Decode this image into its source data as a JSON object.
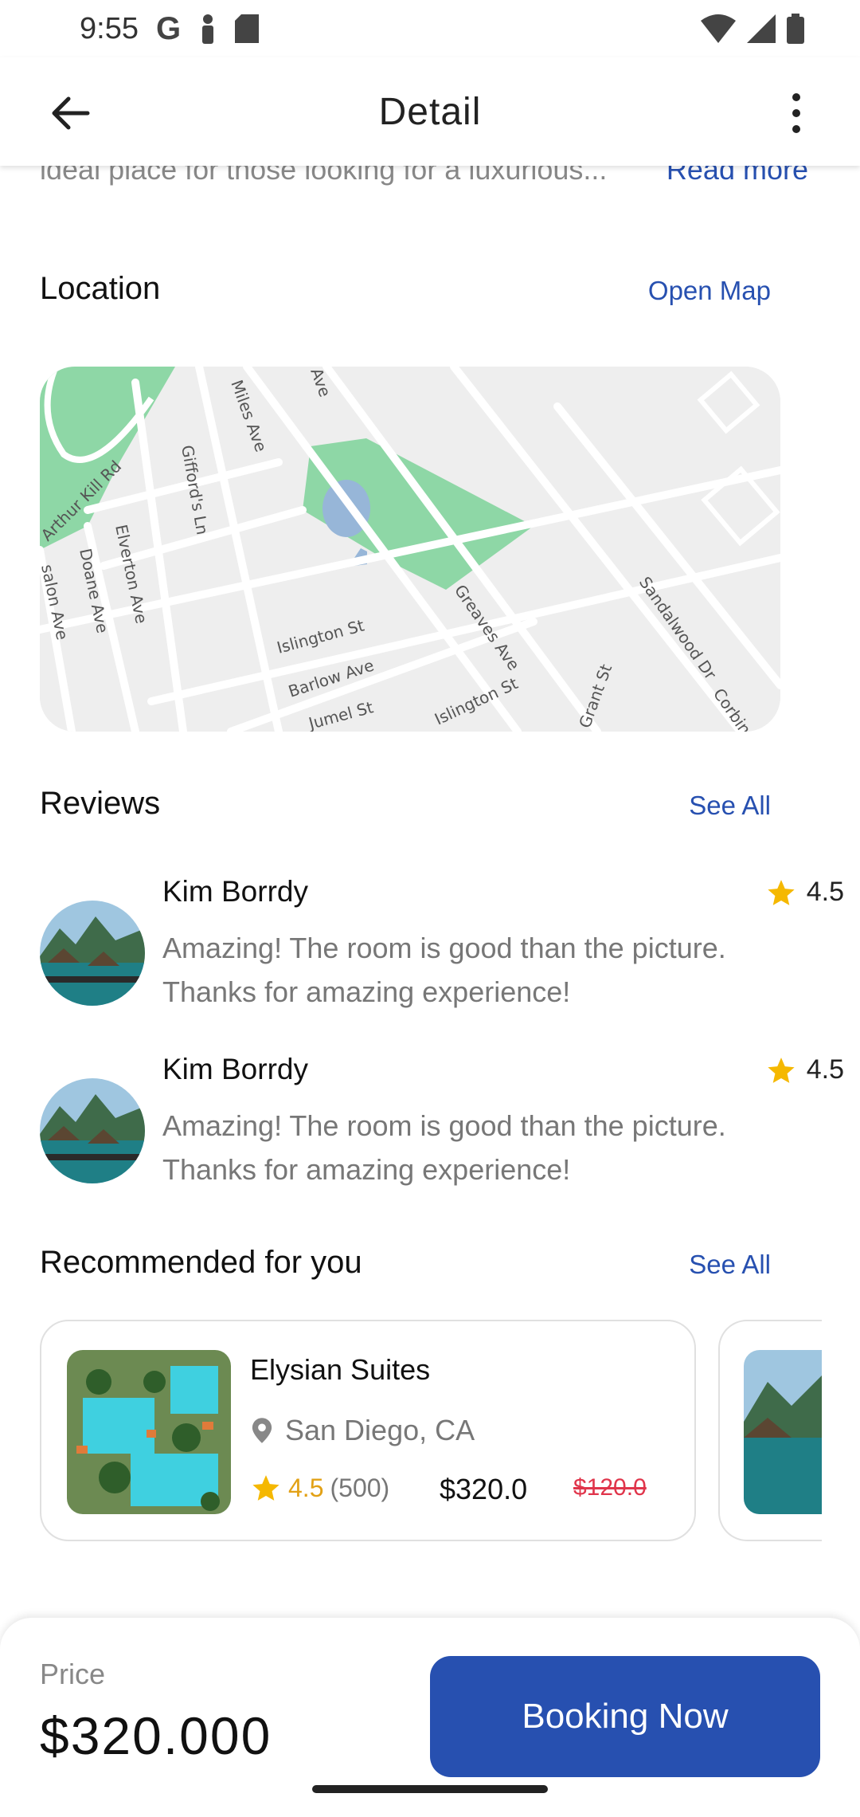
{
  "status_bar": {
    "time": "9:55",
    "google_icon": "G",
    "icons": [
      "person-icon",
      "sd-card-icon",
      "wifi-icon",
      "signal-icon",
      "battery-icon"
    ]
  },
  "app_bar": {
    "title": "Detail",
    "back_icon": "arrow-left-icon",
    "more_icon": "more-vert-icon"
  },
  "description": {
    "text": "ideal place for those looking for a luxurious...",
    "read_more": "Read more"
  },
  "location": {
    "title": "Location",
    "link": "Open Map",
    "map_labels": {
      "road1": "Arthur Kill Rd",
      "road2": "Gifford's Ln",
      "road3": "Miles Ave",
      "road4": "Elverton Ave",
      "road5": "Doane Ave",
      "road6": "Islington St",
      "road7": "Barlow Ave",
      "road8": "Greaves Ave",
      "road9": "Sandalwood Dr",
      "road10": "Corbin",
      "road11": "Jumel St",
      "road12": "Islington St",
      "road13": "Grant St",
      "road14": "Ave",
      "road15": "salon Ave"
    }
  },
  "reviews": {
    "title": "Reviews",
    "link": "See All",
    "items": [
      {
        "name": "Kim Borrdy",
        "rating": "4.5",
        "text": "Amazing!  The room is good than the picture. Thanks for amazing experience!"
      },
      {
        "name": "Kim Borrdy",
        "rating": "4.5",
        "text": "Amazing!  The room is good than the picture. Thanks for amazing experience!"
      }
    ]
  },
  "recommended": {
    "title": "Recommended for you",
    "link": "See All",
    "cards": [
      {
        "title": "Elysian Suites",
        "location": "San Diego, CA",
        "rating": "4.5",
        "count": "(500)",
        "price": "$320.0",
        "old_price": "$120.0"
      }
    ]
  },
  "footer": {
    "price_label": "Price",
    "price_value": "$320.000",
    "button": "Booking Now"
  },
  "colors": {
    "accent": "#2750b0",
    "star": "#f5b800",
    "strike": "#e0354b",
    "park": "#8ed7a6",
    "water": "#97b6d8"
  }
}
